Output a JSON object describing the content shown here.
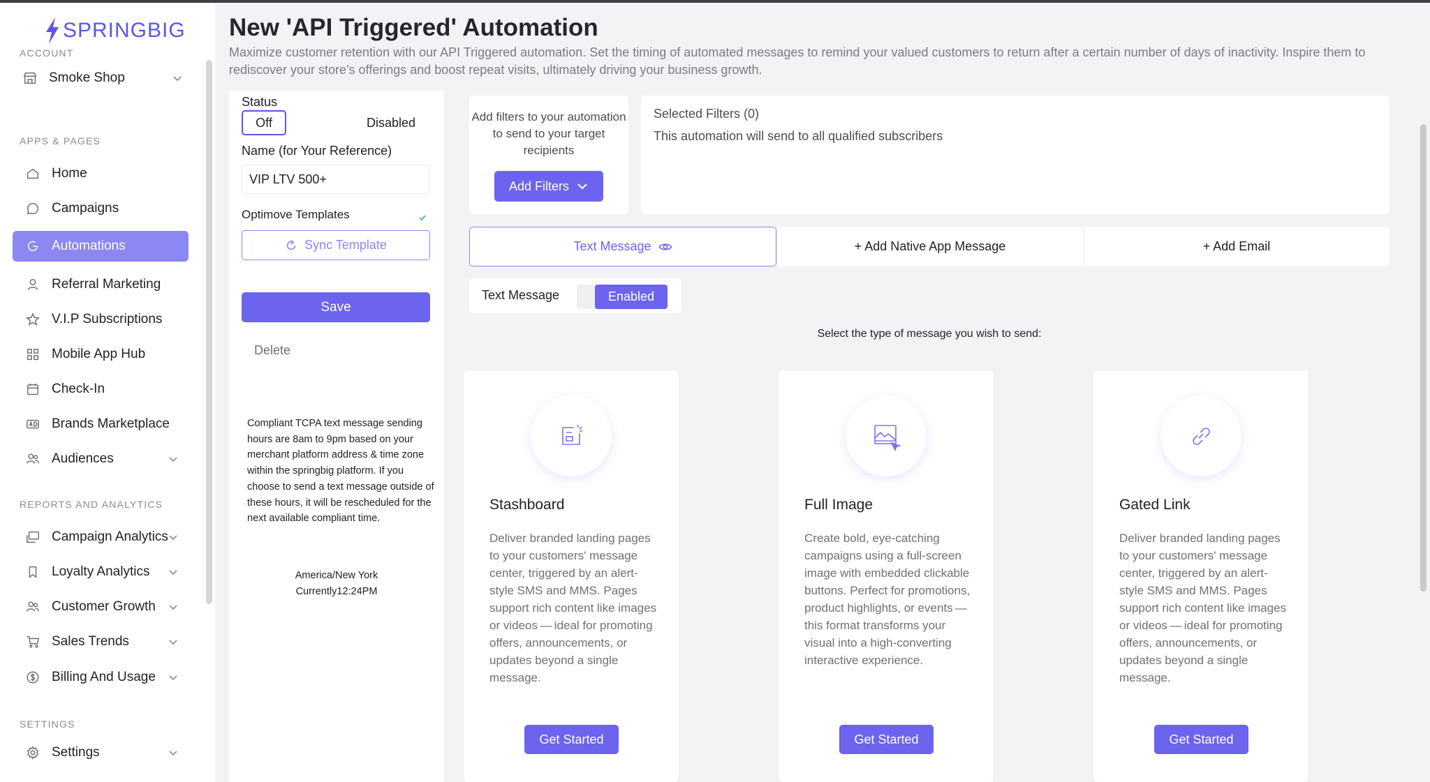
{
  "brand": {
    "name": "SPRINGBIG",
    "color": "#5a57e6"
  },
  "sidebar": {
    "sections": {
      "account": "ACCOUNT",
      "apps": "APPS & PAGES",
      "reports": "REPORTS AND ANALYTICS",
      "settings": "SETTINGS"
    },
    "store": {
      "label": "Smoke Shop",
      "icon": "store-icon"
    },
    "apps_items": [
      {
        "label": "Home",
        "icon": "home-icon",
        "active": false
      },
      {
        "label": "Campaigns",
        "icon": "chat-icon",
        "active": false
      },
      {
        "label": "Automations",
        "icon": "automation-icon",
        "active": true
      },
      {
        "label": "Referral Marketing",
        "icon": "user-icon",
        "active": false
      },
      {
        "label": "V.I.P Subscriptions",
        "icon": "star-icon",
        "active": false
      },
      {
        "label": "Mobile App Hub",
        "icon": "grid-icon",
        "active": false
      },
      {
        "label": "Check-In",
        "icon": "calendar-icon",
        "active": false
      },
      {
        "label": "Brands Marketplace",
        "icon": "ad-icon",
        "active": false
      },
      {
        "label": "Audiences",
        "icon": "users-icon",
        "active": false
      }
    ],
    "report_items": [
      {
        "label": "Campaign Analytics",
        "icon": "analytics-icon"
      },
      {
        "label": "Loyalty Analytics",
        "icon": "loyalty-icon"
      },
      {
        "label": "Customer Growth",
        "icon": "users-icon"
      },
      {
        "label": "Sales Trends",
        "icon": "cart-icon"
      },
      {
        "label": "Billing And Usage",
        "icon": "dollar-icon"
      }
    ],
    "settings_item": {
      "label": "Settings",
      "icon": "gear-icon"
    }
  },
  "header": {
    "title": "New 'API Triggered' Automation",
    "description": "Maximize customer retention with our API Triggered automation. Set the timing of automated messages to remind your valued customers to return after a certain number of days of inactivity. Inspire them to rediscover your store's offerings and boost repeat visits, ultimately driving your business growth."
  },
  "form": {
    "status_label": "Status",
    "status_toggle": "Off",
    "status_value": "Disabled",
    "name_label": "Name (for Your Reference)",
    "name_value": "VIP LTV 500+",
    "templates_label": "Optimove Templates",
    "sync_label": "Sync Template",
    "save_label": "Save",
    "delete_label": "Delete",
    "tcpa_note": "Compliant TCPA text message sending hours are 8am to 9pm based on your merchant platform address & time zone within the springbig platform. If you choose to send a text message outside of these hours, it will be rescheduled for the next available compliant time.",
    "timezone": "America/New York",
    "current_time": "Currently12:24PM"
  },
  "filters": {
    "prompt": "Add filters to your automation to send to your target recipients",
    "button": "Add Filters",
    "selected_title": "Selected Filters (0)",
    "selected_desc": "This automation will send to all qualified subscribers"
  },
  "tabs": [
    {
      "label": "Text Message",
      "active": true
    },
    {
      "label": "+ Add Native App Message",
      "active": false
    },
    {
      "label": "+ Add Email",
      "active": false
    }
  ],
  "text_message": {
    "label": "Text Message",
    "state": "Enabled"
  },
  "select_prompt": "Select the type of message you wish to send:",
  "cards": [
    {
      "title": "Stashboard",
      "icon": "stashboard-icon",
      "desc": "Deliver branded landing pages to your customers' message center, triggered by an alert-style SMS and MMS. Pages support rich content like images or videos — ideal for promoting offers, announcements, or updates beyond a single message.",
      "button": "Get Started"
    },
    {
      "title": "Full Image",
      "icon": "image-icon",
      "desc": "Create bold, eye-catching campaigns using a full-screen image with embedded clickable buttons. Perfect for promotions, product highlights, or events — this format transforms your visual into a high-converting interactive experience.",
      "button": "Get Started"
    },
    {
      "title": "Gated Link",
      "icon": "link-icon",
      "desc": "Deliver branded landing pages to your customers' message center, triggered by an alert-style SMS and MMS. Pages support rich content like images or videos — ideal for promoting offers, announcements, or updates beyond a single message.",
      "button": "Get Started"
    }
  ]
}
